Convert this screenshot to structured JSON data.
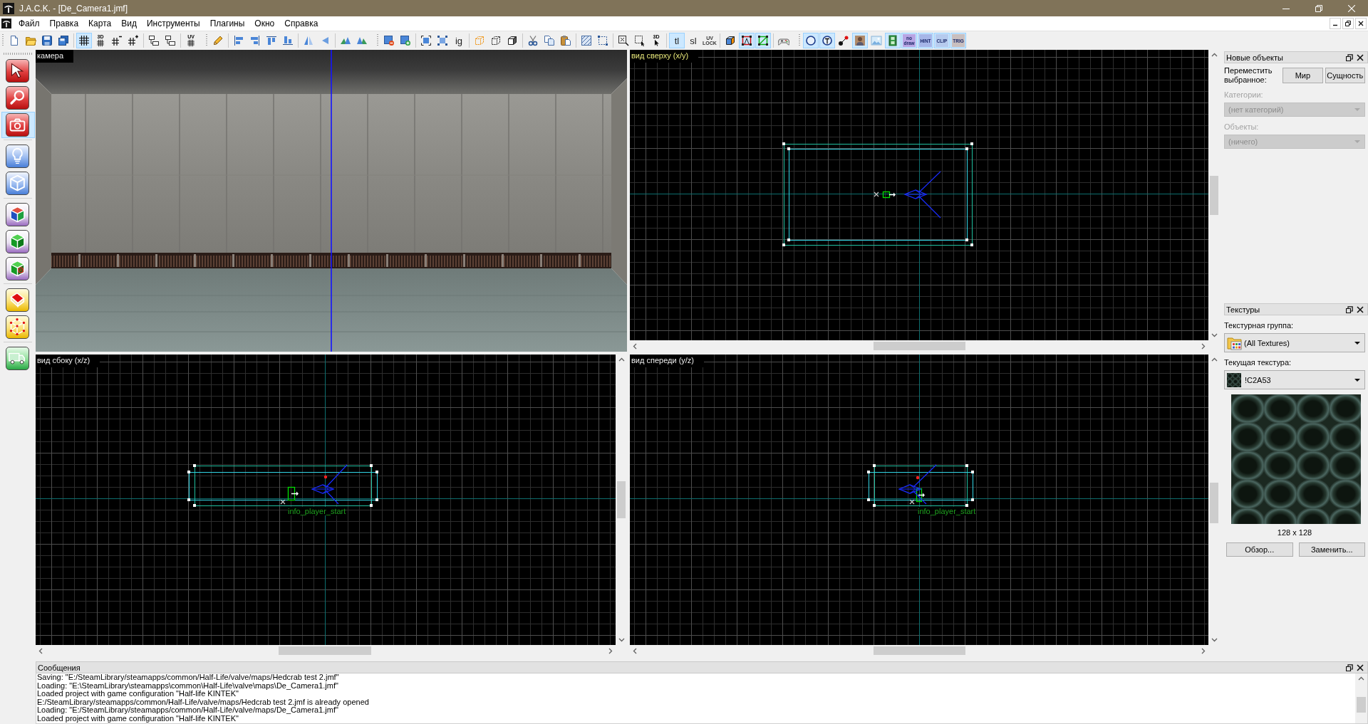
{
  "window": {
    "title": "J.A.C.K. - [De_Camera1.jmf]"
  },
  "menu": [
    "Файл",
    "Правка",
    "Карта",
    "Вид",
    "Инструменты",
    "Плагины",
    "Окно",
    "Справка"
  ],
  "toolbars": [
    [
      [
        {
          "kind": "icon",
          "pressed": false
        },
        {
          "kind": "icon",
          "pressed": false
        },
        {
          "kind": "icon",
          "pressed": false
        },
        {
          "kind": "icon",
          "pressed": false
        }
      ],
      [
        {
          "kind": "icon",
          "pressed": true
        },
        {
          "kind": "icon",
          "label": "3D",
          "pressed": false
        },
        {
          "kind": "icon",
          "pressed": false
        },
        {
          "kind": "icon",
          "pressed": false
        }
      ],
      [
        {
          "kind": "icon",
          "pressed": false
        },
        {
          "kind": "icon",
          "pressed": false
        }
      ],
      [
        {
          "kind": "icon",
          "label": "UV",
          "pressed": false
        }
      ]
    ],
    [
      [
        {
          "kind": "icon",
          "pressed": false
        }
      ],
      [
        {
          "kind": "icon",
          "pressed": false
        },
        {
          "kind": "icon",
          "pressed": false
        },
        {
          "kind": "icon",
          "pressed": false
        },
        {
          "kind": "icon",
          "pressed": false
        }
      ],
      [
        {
          "kind": "icon",
          "pressed": false
        },
        {
          "kind": "icon",
          "pressed": false
        }
      ],
      [
        {
          "kind": "icon",
          "pressed": false
        },
        {
          "kind": "icon",
          "pressed": false
        }
      ]
    ],
    [
      [
        {
          "kind": "icon",
          "pressed": false
        },
        {
          "kind": "icon",
          "pressed": false
        }
      ],
      [
        {
          "kind": "icon",
          "pressed": false
        },
        {
          "kind": "icon",
          "pressed": false
        },
        {
          "kind": "text",
          "label": "ig",
          "pressed": false
        }
      ],
      [
        {
          "kind": "icon",
          "pressed": false
        },
        {
          "kind": "icon",
          "pressed": false
        },
        {
          "kind": "icon",
          "pressed": false
        }
      ],
      [
        {
          "kind": "icon",
          "pressed": false
        },
        {
          "kind": "icon",
          "pressed": false
        },
        {
          "kind": "icon",
          "pressed": false
        }
      ],
      [
        {
          "kind": "icon",
          "pressed": false
        },
        {
          "kind": "icon",
          "pressed": false
        }
      ],
      [
        {
          "kind": "icon",
          "pressed": false
        },
        {
          "kind": "icon",
          "pressed": false
        },
        {
          "kind": "icon",
          "label": "3D",
          "pressed": false
        }
      ],
      [
        {
          "kind": "text",
          "label": "tl",
          "pressed": true
        },
        {
          "kind": "text",
          "label": "sl",
          "pressed": false
        },
        {
          "kind": "stack",
          "label": "UV LOCK",
          "pressed": false
        }
      ],
      [
        {
          "kind": "icon",
          "pressed": false
        },
        {
          "kind": "icon",
          "pressed": true
        },
        {
          "kind": "icon",
          "pressed": true
        }
      ],
      [
        {
          "kind": "icon",
          "pressed": false
        }
      ]
    ],
    [
      [
        {
          "kind": "icon",
          "pressed": true
        },
        {
          "kind": "icon",
          "pressed": true
        },
        {
          "kind": "icon",
          "pressed": false
        },
        {
          "kind": "icon",
          "pressed": true
        },
        {
          "kind": "icon",
          "pressed": false
        },
        {
          "kind": "icon",
          "pressed": true
        },
        {
          "kind": "tile",
          "label": "no draw",
          "pressed": true
        },
        {
          "kind": "tile",
          "label": "HINT",
          "pressed": true
        },
        {
          "kind": "tile",
          "label": "CLIP",
          "pressed": true
        },
        {
          "kind": "tile",
          "label": "TRIG",
          "pressed": true
        }
      ]
    ]
  ],
  "tool_palette": [
    [
      {
        "selected": false
      },
      {
        "selected": false
      },
      {
        "selected": true
      }
    ],
    [
      {
        "selected": false
      },
      {
        "selected": false
      }
    ],
    [
      {
        "selected": false
      },
      {
        "selected": false
      },
      {
        "selected": false
      }
    ],
    [
      {
        "selected": false
      },
      {
        "selected": false
      }
    ],
    [
      {
        "selected": false
      }
    ]
  ],
  "viewports": [
    {
      "kind": "camera",
      "label": "камера",
      "active": false
    },
    {
      "kind": "grid",
      "label": "вид сверху (x/y)",
      "active": true
    },
    {
      "kind": "grid",
      "label": "вид сбоку (x/z)",
      "active": false,
      "entity_label": "info_player_start"
    },
    {
      "kind": "grid",
      "label": "вид спереди (y/z)",
      "active": false,
      "entity_label": "info_player_start"
    }
  ],
  "new_objects": {
    "title": "Новые объекты",
    "move_label": "Переместить выбранное:",
    "buttons": [
      "Мир",
      "Сущность"
    ],
    "categories": {
      "label": "Категории:",
      "value": "(нет категорий)",
      "disabled": true
    },
    "objects": {
      "label": "Объекты:",
      "value": "(ничего)",
      "disabled": true
    }
  },
  "textures": {
    "title": "Текстуры",
    "group": {
      "label": "Текстурная группа:",
      "value": "(All Textures)"
    },
    "current": {
      "label": "Текущая текстура:",
      "value": "!C2A53"
    },
    "size": "128 x 128",
    "buttons": [
      "Обзор...",
      "Заменить..."
    ]
  },
  "messages": {
    "title": "Сообщения",
    "lines": [
      "Saving: \"E:/SteamLibrary/steamapps/common/Half-Life/valve/maps/Hedcrab test 2.jmf\"",
      "Loading: \"E:\\SteamLibrary\\steamapps\\common\\Half-Life\\valve\\maps\\De_Camera1.jmf\"",
      "Loaded project with game configuration \"Half-life KINTEK\"",
      "E:/SteamLibrary/steamapps/common/Half-Life/valve/maps/Hedcrab test 2.jmf is already opened",
      "Loading: \"E:/SteamLibrary/steamapps/common/Half-Life/valve/maps/De_Camera1.jmf\"",
      "Loaded project with game configuration \"Half-life KINTEK\""
    ]
  }
}
